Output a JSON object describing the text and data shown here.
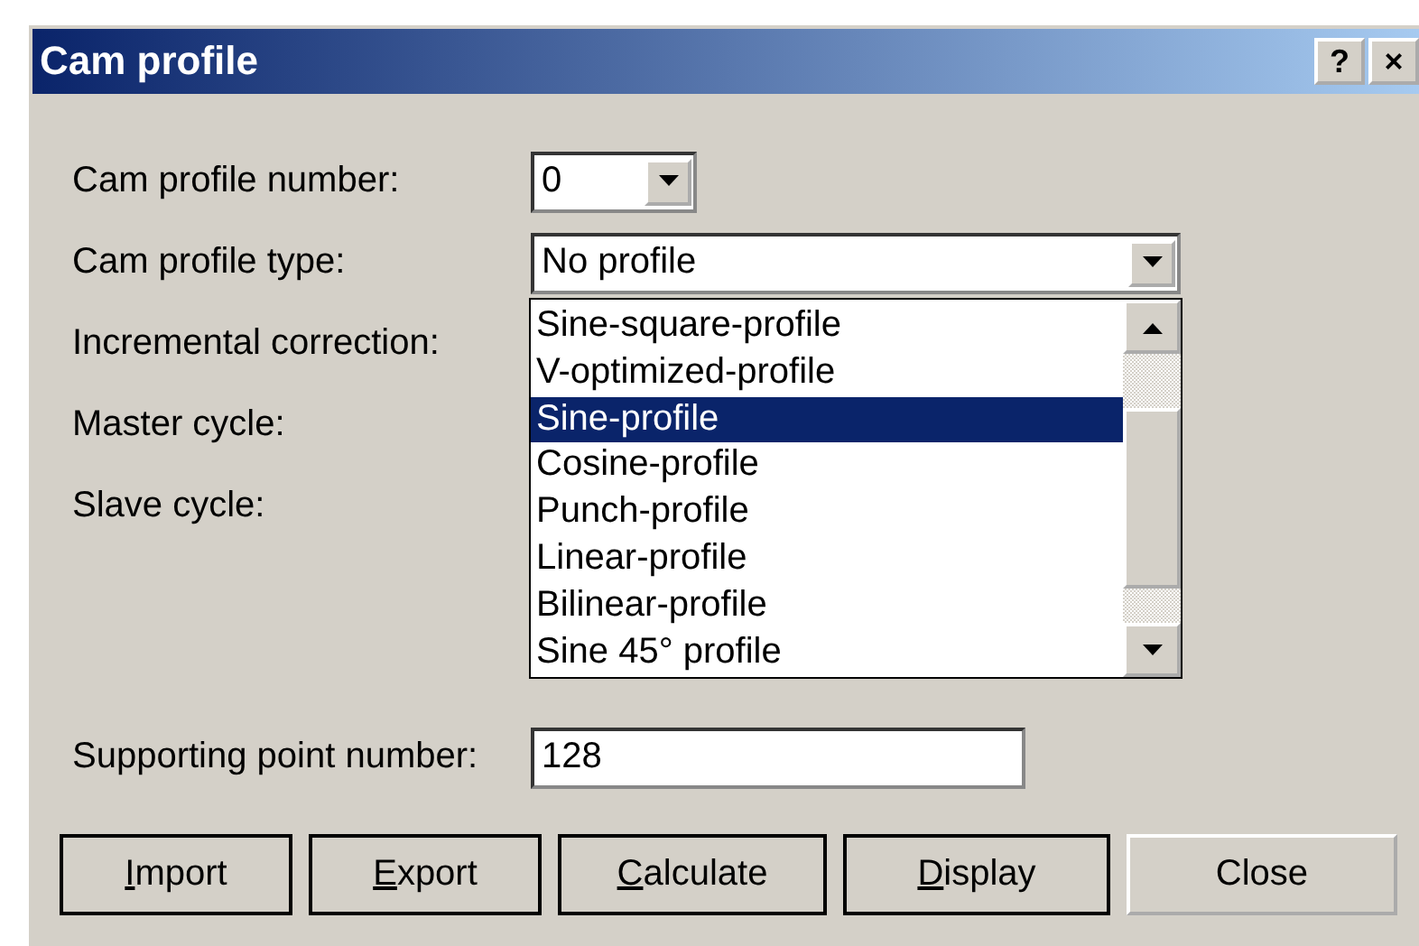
{
  "window": {
    "title": "Cam profile",
    "help_button": "?",
    "close_button": "×"
  },
  "fields": [
    {
      "label": "Cam profile number:",
      "kind": "small-combo",
      "value": "0"
    },
    {
      "label": "Cam profile type:",
      "kind": "combo",
      "value": "No profile"
    },
    {
      "label": "Incremental correction:",
      "kind": "hidden"
    },
    {
      "label": "Master cycle:",
      "kind": "hidden"
    },
    {
      "label": "Slave cycle:",
      "kind": "hidden"
    }
  ],
  "dropdown": {
    "expanded": true,
    "options": [
      {
        "label": "Sine-square-profile",
        "selected": false
      },
      {
        "label": "V-optimized-profile",
        "selected": false
      },
      {
        "label": "Sine-profile",
        "selected": true
      },
      {
        "label": "Cosine-profile",
        "selected": false
      },
      {
        "label": "Punch-profile",
        "selected": false
      },
      {
        "label": "Linear-profile",
        "selected": false
      },
      {
        "label": "Bilinear-profile",
        "selected": false
      },
      {
        "label": "Sine 45° profile",
        "selected": false
      }
    ]
  },
  "supporting_point": {
    "label": "Supporting point number:",
    "value": "128"
  },
  "buttons": [
    {
      "accel": "I",
      "rest": "mport",
      "emphasized": true
    },
    {
      "accel": "E",
      "rest": "xport",
      "emphasized": true
    },
    {
      "accel": "C",
      "rest": "alculate",
      "emphasized": true
    },
    {
      "accel": "D",
      "rest": "isplay",
      "emphasized": true
    },
    {
      "rest": "Close",
      "emphasized": false
    }
  ]
}
